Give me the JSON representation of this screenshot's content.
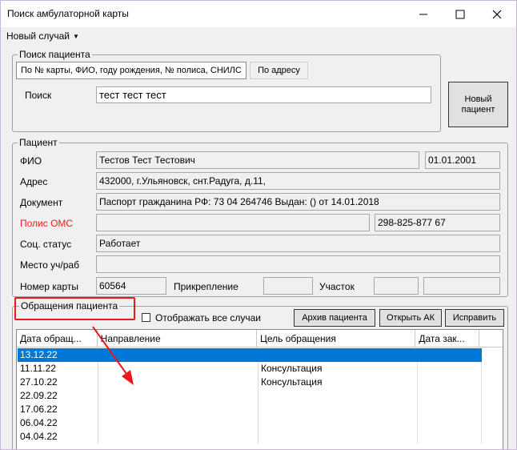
{
  "window": {
    "title": "Поиск амбулаторной карты"
  },
  "menu": {
    "new_case": "Новый случай"
  },
  "search": {
    "group_title": "Поиск пациента",
    "tabs": [
      "По № карты, ФИО, году рождения, № полиса, СНИЛС",
      "По адресу"
    ],
    "label": "Поиск",
    "value": "тест тест тест",
    "new_patient_button": "Новый пациент"
  },
  "patient": {
    "group_title": "Пациент",
    "fio_label": "ФИО",
    "fio": "Тестов Тест Тестович",
    "birth_date": "01.01.2001",
    "address_label": "Адрес",
    "address": "432000, г.Ульяновск, снт.Радуга, д.11,",
    "document_label": "Документ",
    "document": "Паспорт гражданина РФ: 73 04 264746 Выдан: () от 14.01.2018",
    "oms_label": "Полис ОМС",
    "oms_value": "",
    "snils": "298-825-877 67",
    "social_label": "Соц. статус",
    "social": "Работает",
    "workplace_label": "Место уч/раб",
    "workplace": "",
    "card_label": "Номер карты",
    "card_number": "60564",
    "attachment_label": "Прикрепление",
    "attachment": "",
    "district_label": "Участок",
    "district": "",
    "district2": ""
  },
  "visits": {
    "group_title": "Обращения пациента",
    "show_all_label": "Отображать все случаи",
    "show_all_checked": false,
    "archive_button": "Архив пациента",
    "open_ak_button": "Открыть АК",
    "fix_button": "Исправить",
    "columns": [
      "Дата обращ...",
      "Направление",
      "Цель обращения",
      "Дата зак..."
    ],
    "rows": [
      {
        "date": "13.12.22",
        "direction": "",
        "purpose": "",
        "close_date": "",
        "selected": true
      },
      {
        "date": "11.11.22",
        "direction": "",
        "purpose": "Консультация",
        "close_date": ""
      },
      {
        "date": "27.10.22",
        "direction": "",
        "purpose": "Консультация",
        "close_date": ""
      },
      {
        "date": "22.09.22",
        "direction": "",
        "purpose": "",
        "close_date": ""
      },
      {
        "date": "17.06.22",
        "direction": "",
        "purpose": "",
        "close_date": ""
      },
      {
        "date": "06.04.22",
        "direction": "",
        "purpose": "",
        "close_date": ""
      },
      {
        "date": "04.04.22",
        "direction": "",
        "purpose": "",
        "close_date": ""
      }
    ]
  },
  "colors": {
    "selection": "#0078d7",
    "oms_label": "#e81b1b",
    "annotation": "#e8191a"
  },
  "icons": [
    "minimize-icon",
    "maximize-icon",
    "close-icon",
    "chevron-down-icon",
    "arrow-annotation-icon"
  ]
}
